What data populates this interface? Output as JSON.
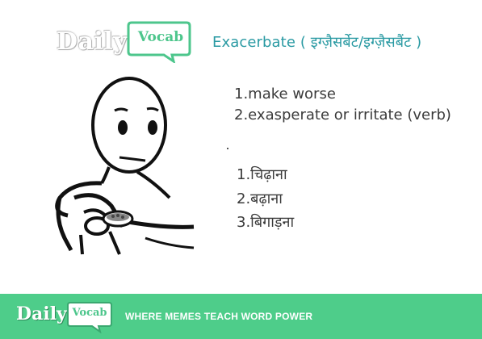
{
  "brand": {
    "daily": "Daily",
    "vocab": "Vocab",
    "accent_color": "#4ecd8a",
    "title_color": "#2a9aa3"
  },
  "word": {
    "title": "Exacerbate ( इग्ज़ैसर्बेट/इग्ज़ैसबैंट )"
  },
  "english_meanings": [
    "1.make worse",
    "2.exasperate or irritate (verb)"
  ],
  "hindi_meanings": [
    "1.चिढ़ाना",
    "2.बढ़ाना",
    "3.बिगाड़ना"
  ],
  "footer": {
    "daily": "Daily",
    "vocab": "Vocab",
    "tagline": "WHERE MEMES TEACH WORD POWER"
  },
  "meme": {
    "icon": "cereal-guy-meme"
  }
}
